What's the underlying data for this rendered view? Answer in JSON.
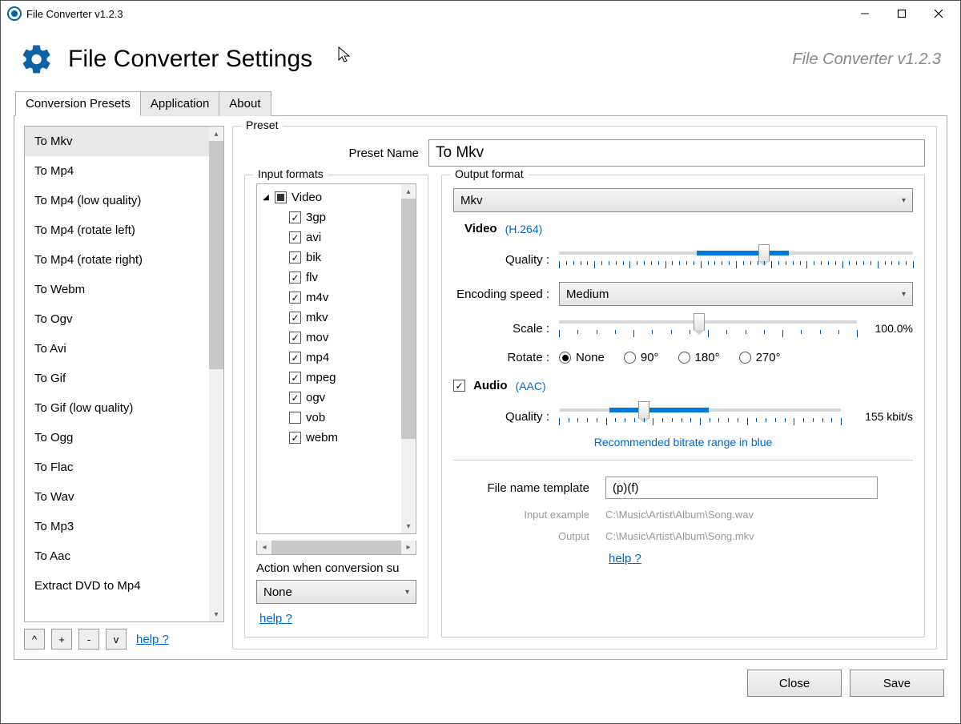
{
  "window": {
    "title": "File Converter v1.2.3"
  },
  "header": {
    "title": "File Converter Settings",
    "version": "File Converter v1.2.3"
  },
  "tabs": [
    {
      "label": "Conversion Presets",
      "active": true
    },
    {
      "label": "Application",
      "active": false
    },
    {
      "label": "About",
      "active": false
    }
  ],
  "presets": {
    "items": [
      "To Mkv",
      "To Mp4",
      "To Mp4 (low quality)",
      "To Mp4 (rotate left)",
      "To Mp4 (rotate right)",
      "To Webm",
      "To Ogv",
      "To Avi",
      "To Gif",
      "To Gif (low quality)",
      "To Ogg",
      "To Flac",
      "To Wav",
      "To Mp3",
      "To Aac",
      "Extract DVD to Mp4"
    ],
    "selected_index": 0,
    "buttons": {
      "up": "^",
      "add": "+",
      "remove": "-",
      "down": "v"
    },
    "help": "help ?"
  },
  "preset_panel": {
    "legend": "Preset",
    "name_label": "Preset Name",
    "name_value": "To Mkv"
  },
  "input_formats": {
    "legend": "Input formats",
    "root_label": "Video",
    "root_state": "indeterminate",
    "items": [
      {
        "label": "3gp",
        "checked": true
      },
      {
        "label": "avi",
        "checked": true
      },
      {
        "label": "bik",
        "checked": true
      },
      {
        "label": "flv",
        "checked": true
      },
      {
        "label": "m4v",
        "checked": true
      },
      {
        "label": "mkv",
        "checked": true
      },
      {
        "label": "mov",
        "checked": true
      },
      {
        "label": "mp4",
        "checked": true
      },
      {
        "label": "mpeg",
        "checked": true
      },
      {
        "label": "ogv",
        "checked": true
      },
      {
        "label": "vob",
        "checked": false
      },
      {
        "label": "webm",
        "checked": true
      }
    ],
    "action_label": "Action when conversion su",
    "action_value": "None",
    "help": "help ?"
  },
  "output": {
    "legend": "Output format",
    "format_value": "Mkv",
    "video": {
      "heading": "Video",
      "codec": "(H.264)",
      "quality_label": "Quality :",
      "encoding_speed_label": "Encoding speed :",
      "encoding_speed_value": "Medium",
      "scale_label": "Scale :",
      "scale_value": "100.0%",
      "rotate_label": "Rotate :",
      "rotate_options": [
        "None",
        "90°",
        "180°",
        "270°"
      ],
      "rotate_selected": "None"
    },
    "audio": {
      "enabled": true,
      "heading": "Audio",
      "codec": "(AAC)",
      "quality_label": "Quality :",
      "quality_value": "155 kbit/s",
      "hint": "Recommended bitrate range in blue"
    },
    "template": {
      "label": "File name template",
      "value": "(p)(f)",
      "input_example_label": "Input example",
      "input_example_value": "C:\\Music\\Artist\\Album\\Song.wav",
      "output_label": "Output",
      "output_value": "C:\\Music\\Artist\\Album\\Song.mkv",
      "help": "help ?"
    }
  },
  "footer": {
    "close": "Close",
    "save": "Save"
  }
}
